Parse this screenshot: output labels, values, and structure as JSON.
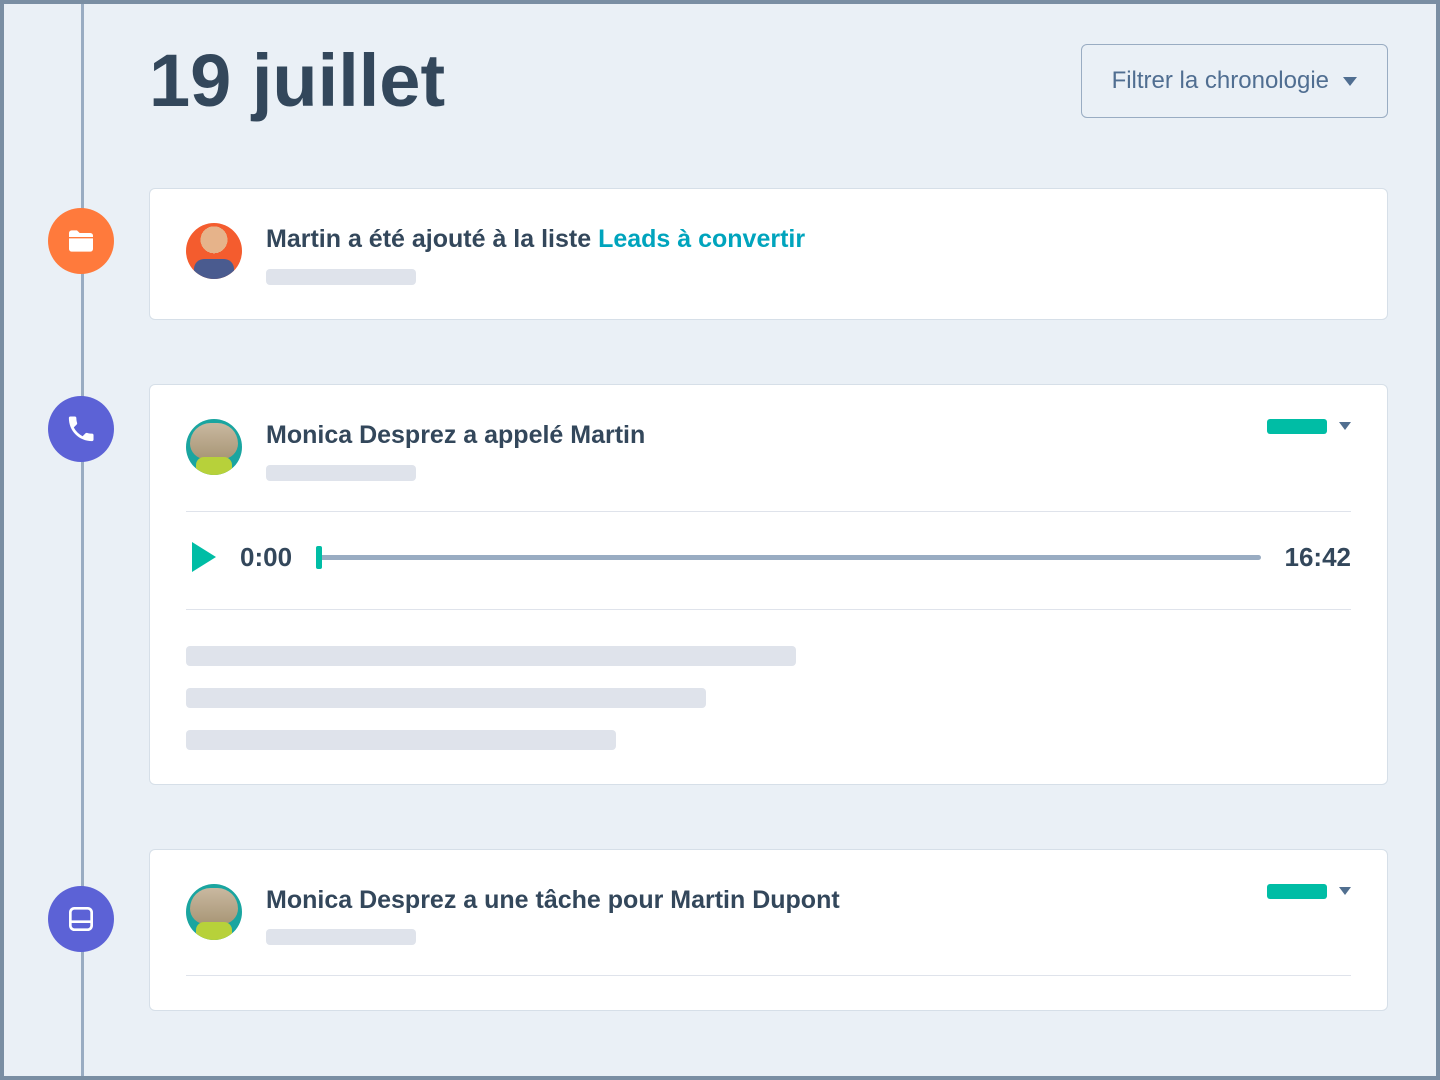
{
  "header": {
    "date_title": "19 juillet",
    "filter_label": "Filtrer la chronologie"
  },
  "timeline": [
    {
      "icon": "folder-icon",
      "avatar": "martin",
      "title_prefix": "Martin a été ajouté à la liste ",
      "title_link": "Leads à convertir"
    },
    {
      "icon": "phone-icon",
      "avatar": "monica",
      "title": "Monica Desprez a appelé Martin",
      "audio": {
        "current_time": "0:00",
        "duration": "16:42"
      },
      "status_badge": true
    },
    {
      "icon": "note-icon",
      "avatar": "monica",
      "title": "Monica Desprez a une tâche pour Martin Dupont",
      "status_badge": true
    }
  ]
}
